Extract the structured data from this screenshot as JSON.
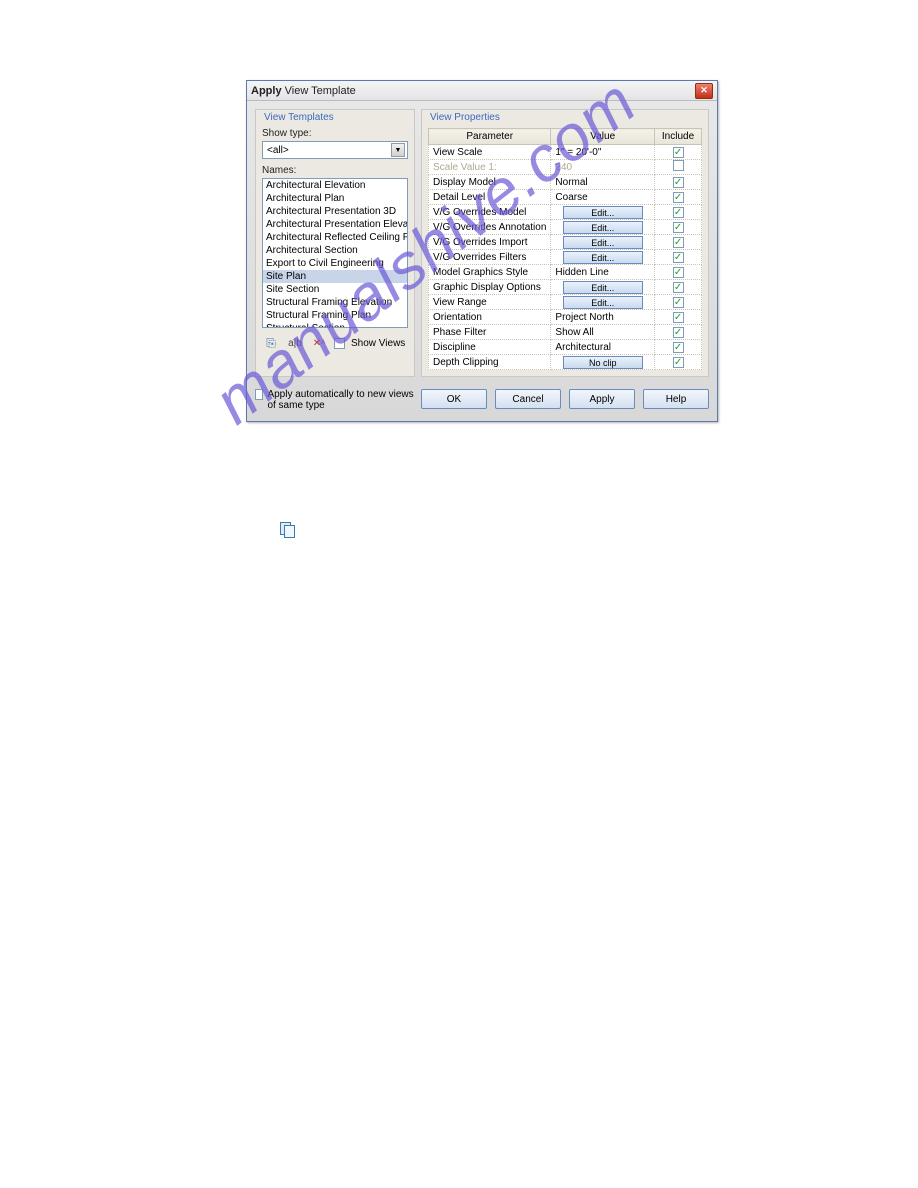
{
  "dialog": {
    "title_bold": "Apply",
    "title_rest": " View Template"
  },
  "left": {
    "fieldset_title": "View Templates",
    "show_type_label": "Show type:",
    "show_type_value": "<all>",
    "names_label": "Names:",
    "items": [
      "Architectural Elevation",
      "Architectural Plan",
      "Architectural Presentation 3D",
      "Architectural Presentation Elevation",
      "Architectural Reflected Ceiling Plan",
      "Architectural Section",
      "Export to Civil Engineering",
      "Site Plan",
      "Site Section",
      "Structural Framing Elevation",
      "Structural Framing Plan",
      "Structural Section"
    ],
    "selected_index": 7,
    "show_views_label": "Show Views"
  },
  "right": {
    "fieldset_title": "View Properties",
    "headers": {
      "param": "Parameter",
      "value": "Value",
      "include": "Include"
    },
    "rows": [
      {
        "param": "View Scale",
        "value": "1\" = 20'-0\"",
        "btn": false,
        "include": true,
        "disabled": false
      },
      {
        "param": "Scale Value    1:",
        "value": "240",
        "btn": false,
        "include": false,
        "disabled": true
      },
      {
        "param": "Display Model",
        "value": "Normal",
        "btn": false,
        "include": true,
        "disabled": false
      },
      {
        "param": "Detail Level",
        "value": "Coarse",
        "btn": false,
        "include": true,
        "disabled": false
      },
      {
        "param": "V/G Overrides Model",
        "value": "Edit...",
        "btn": true,
        "include": true,
        "disabled": false
      },
      {
        "param": "V/G Overrides Annotation",
        "value": "Edit...",
        "btn": true,
        "include": true,
        "disabled": false
      },
      {
        "param": "V/G Overrides Import",
        "value": "Edit...",
        "btn": true,
        "include": true,
        "disabled": false
      },
      {
        "param": "V/G Overrides Filters",
        "value": "Edit...",
        "btn": true,
        "include": true,
        "disabled": false
      },
      {
        "param": "Model Graphics Style",
        "value": "Hidden Line",
        "btn": false,
        "include": true,
        "disabled": false
      },
      {
        "param": "Graphic Display Options",
        "value": "Edit...",
        "btn": true,
        "include": true,
        "disabled": false
      },
      {
        "param": "View Range",
        "value": "Edit...",
        "btn": true,
        "include": true,
        "disabled": false
      },
      {
        "param": "Orientation",
        "value": "Project North",
        "btn": false,
        "include": true,
        "disabled": false
      },
      {
        "param": "Phase Filter",
        "value": "Show All",
        "btn": false,
        "include": true,
        "disabled": false
      },
      {
        "param": "Discipline",
        "value": "Architectural",
        "btn": false,
        "include": true,
        "disabled": false
      },
      {
        "param": "Depth Clipping",
        "value": "No clip",
        "btn": true,
        "include": true,
        "disabled": false
      }
    ]
  },
  "bottom": {
    "auto_apply": "Apply automatically to new views of same type",
    "ok": "OK",
    "cancel": "Cancel",
    "apply": "Apply",
    "help": "Help"
  },
  "watermark": "manualshive.com"
}
